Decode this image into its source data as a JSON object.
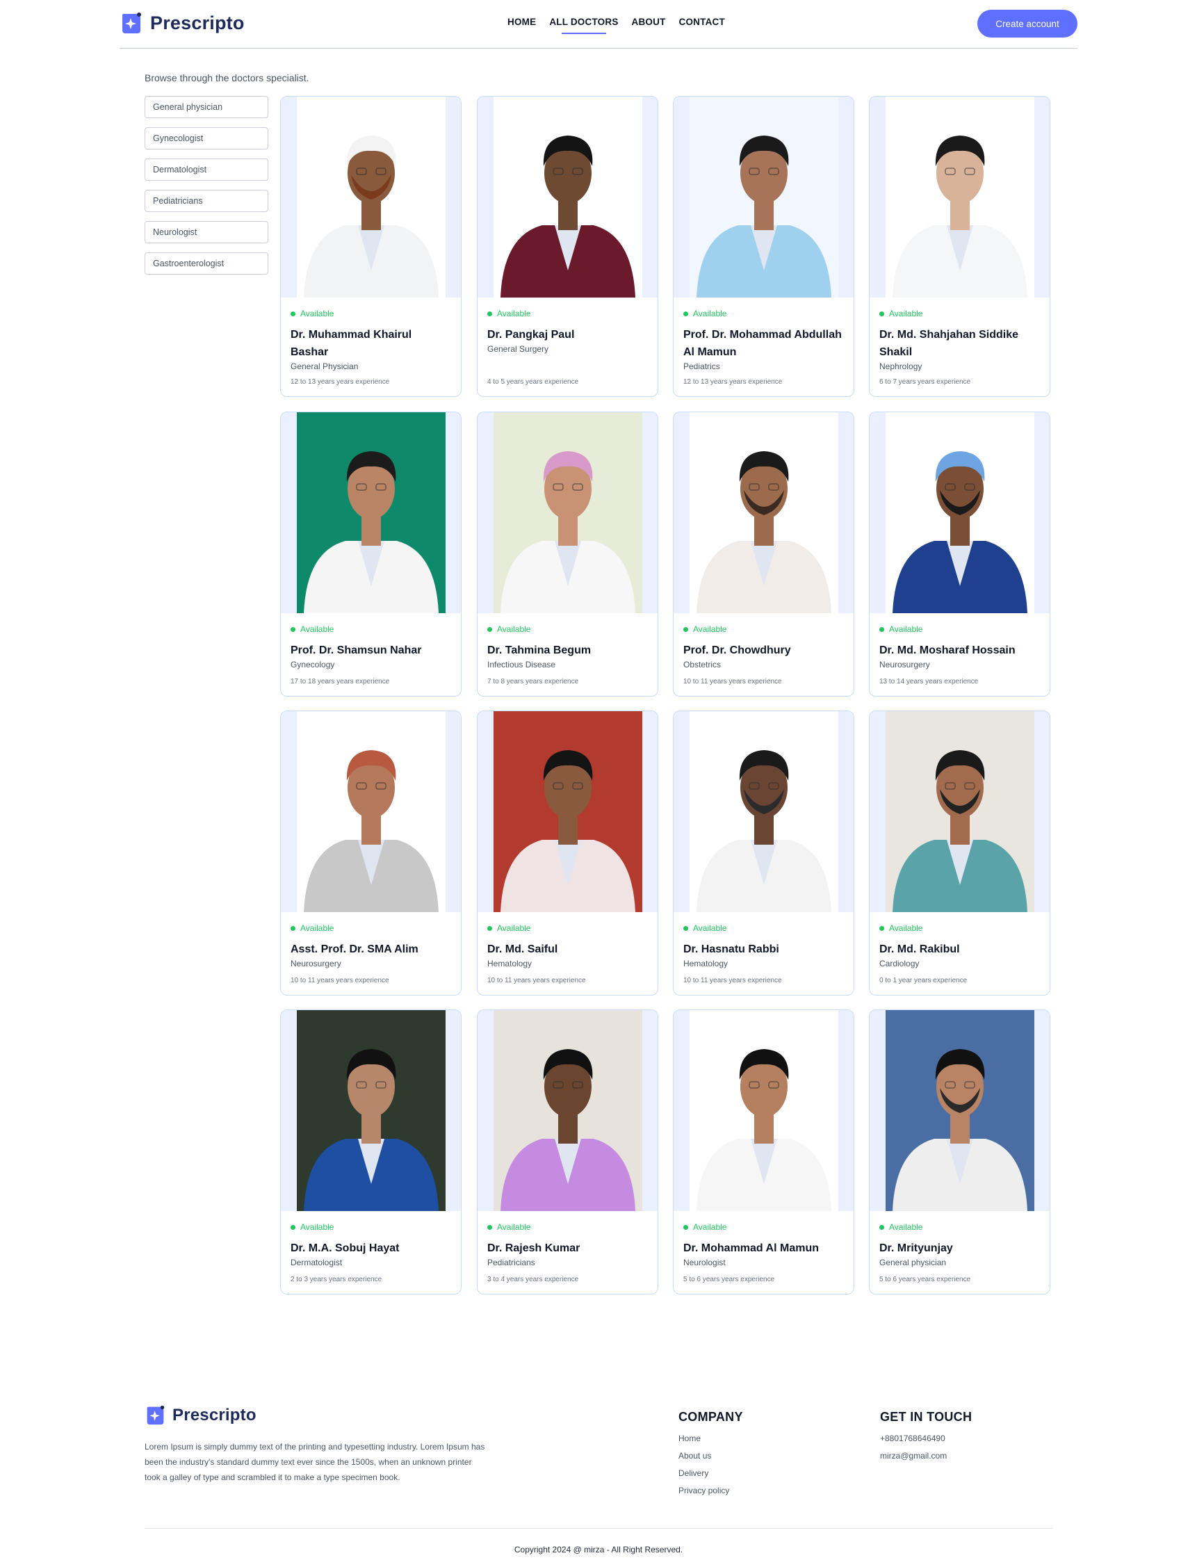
{
  "brand": {
    "name": "Prescripto",
    "accent": "#5f6fff",
    "dark": "#1e2a5a"
  },
  "nav": [
    {
      "label": "HOME",
      "active": false
    },
    {
      "label": "ALL DOCTORS",
      "active": true
    },
    {
      "label": "ABOUT",
      "active": false
    },
    {
      "label": "CONTACT",
      "active": false
    }
  ],
  "header": {
    "cta_label": "Create account"
  },
  "intro": "Browse through the doctors specialist.",
  "filters": [
    "General physician",
    "Gynecologist",
    "Dermatologist",
    "Pediatricians",
    "Neurologist",
    "Gastroenterologist"
  ],
  "doctors": [
    {
      "status": "Available",
      "name": "Dr. Muhammad Khairul Bashar",
      "specialty": "General Physician",
      "experience": "12 to 13 years years experience",
      "photo": {
        "bg": "#ffffff",
        "skin": "#8a5a3c",
        "hair": "#f3f3f3",
        "coat": "#f1f3f5",
        "beard": "#7a3b1d"
      }
    },
    {
      "status": "Available",
      "name": "Dr. Pangkaj Paul",
      "specialty": "General Surgery",
      "experience": "4 to 5 years years experience",
      "photo": {
        "bg": "#ffffff",
        "skin": "#6e4a33",
        "hair": "#141414",
        "coat": "#6b1a2b",
        "beard": ""
      }
    },
    {
      "status": "Available",
      "name": "Prof. Dr. Mohammad Abdullah Al Mamun",
      "specialty": "Pediatrics",
      "experience": "12 to 13 years years experience",
      "photo": {
        "bg": "#f2f7ff",
        "skin": "#a7745a",
        "hair": "#1a1a1a",
        "coat": "#9fd1ef",
        "beard": ""
      }
    },
    {
      "status": "Available",
      "name": "Dr. Md. Shahjahan Siddike Shakil",
      "specialty": "Nephrology",
      "experience": "6 to 7 years years experience",
      "photo": {
        "bg": "#ffffff",
        "skin": "#d8b39a",
        "hair": "#1a1a1a",
        "coat": "#f4f6f8",
        "beard": ""
      }
    },
    {
      "status": "Available",
      "name": "Prof. Dr. Shamsun Nahar",
      "specialty": "Gynecology",
      "experience": "17 to 18 years years experience",
      "photo": {
        "bg": "#0e8a6a",
        "skin": "#b98566",
        "hair": "#1c1c1c",
        "coat": "#f5f5f5",
        "beard": ""
      }
    },
    {
      "status": "Available",
      "name": "Dr. Tahmina Begum",
      "specialty": "Infectious Disease",
      "experience": "7 to 8 years years experience",
      "photo": {
        "bg": "#e6ecd8",
        "skin": "#c99274",
        "hair": "#d79ac9",
        "coat": "#f7f7f7",
        "beard": ""
      }
    },
    {
      "status": "Available",
      "name": "Prof. Dr. Chowdhury",
      "specialty": "Obstetrics",
      "experience": "10 to 11 years years experience",
      "photo": {
        "bg": "#ffffff",
        "skin": "#9c6a4c",
        "hair": "#1a1a1a",
        "coat": "#f1ece8",
        "beard": "#3a2a22"
      }
    },
    {
      "status": "Available",
      "name": "Dr. Md. Mosharaf Hossain",
      "specialty": "Neurosurgery",
      "experience": "13 to 14 years years experience",
      "photo": {
        "bg": "#ffffff",
        "skin": "#7b4f36",
        "hair": "#6fa4e2",
        "coat": "#1f3f8f",
        "beard": "#1a1a1a"
      }
    },
    {
      "status": "Available",
      "name": "Asst. Prof. Dr. SMA Alim",
      "specialty": "Neurosurgery",
      "experience": "10 to 11 years years experience",
      "photo": {
        "bg": "#ffffff",
        "skin": "#b4785a",
        "hair": "#b85a40",
        "coat": "#c8c8c8",
        "beard": ""
      }
    },
    {
      "status": "Available",
      "name": "Dr. Md. Saiful",
      "specialty": "Hematology",
      "experience": "10 to 11 years years experience",
      "photo": {
        "bg": "#b33a2e",
        "skin": "#8a5a3e",
        "hair": "#141414",
        "coat": "#efe3e3",
        "beard": ""
      }
    },
    {
      "status": "Available",
      "name": "Dr. Hasnatu Rabbi",
      "specialty": "Hematology",
      "experience": "10 to 11 years years experience",
      "photo": {
        "bg": "#ffffff",
        "skin": "#6a4533",
        "hair": "#1a1a1a",
        "coat": "#f3f3f3",
        "beard": "#2b2b2b"
      }
    },
    {
      "status": "Available",
      "name": "Dr. Md. Rakibul",
      "specialty": "Cardiology",
      "experience": "0 to 1 year years experience",
      "photo": {
        "bg": "#e9e5df",
        "skin": "#a26b4e",
        "hair": "#1a1a1a",
        "coat": "#5aa3a9",
        "beard": "#222222"
      }
    },
    {
      "status": "Available",
      "name": "Dr. M.A. Sobuj Hayat",
      "specialty": "Dermatologist",
      "experience": "2 to 3 years years experience",
      "photo": {
        "bg": "#2d3a2d",
        "skin": "#b7876b",
        "hair": "#111111",
        "coat": "#1f4fa3",
        "beard": ""
      }
    },
    {
      "status": "Available",
      "name": "Dr. Rajesh Kumar",
      "specialty": "Pediatricians",
      "experience": "3 to 4 years years experience",
      "photo": {
        "bg": "#e7e3dc",
        "skin": "#6a4530",
        "hair": "#111111",
        "coat": "#c58be0",
        "beard": ""
      }
    },
    {
      "status": "Available",
      "name": "Dr. Mohammad Al Mamun",
      "specialty": "Neurologist",
      "experience": "5 to 6 years years experience",
      "photo": {
        "bg": "#ffffff",
        "skin": "#b4805f",
        "hair": "#111111",
        "coat": "#f6f6f6",
        "beard": ""
      }
    },
    {
      "status": "Available",
      "name": "Dr. Mrityunjay",
      "specialty": "General physician",
      "experience": "5 to 6 years years experience",
      "photo": {
        "bg": "#4a6ea3",
        "skin": "#b98466",
        "hair": "#111111",
        "coat": "#eeeeee",
        "beard": "#2a2a2a"
      }
    }
  ],
  "footer": {
    "brand": "Prescripto",
    "description": "Lorem Ipsum is simply dummy text of the printing and typesetting industry. Lorem Ipsum has been the industry's standard dummy text ever since the 1500s, when an unknown printer took a galley of type and scrambled it to make a type specimen book.",
    "company_title": "COMPANY",
    "company_links": [
      "Home",
      "About us",
      "Delivery",
      "Privacy policy"
    ],
    "contact_title": "GET IN TOUCH",
    "contact": [
      "+8801768646490",
      "mirza@gmail.com"
    ],
    "copyright": "Copyright 2024 @ mirza - All Right Reserved."
  }
}
